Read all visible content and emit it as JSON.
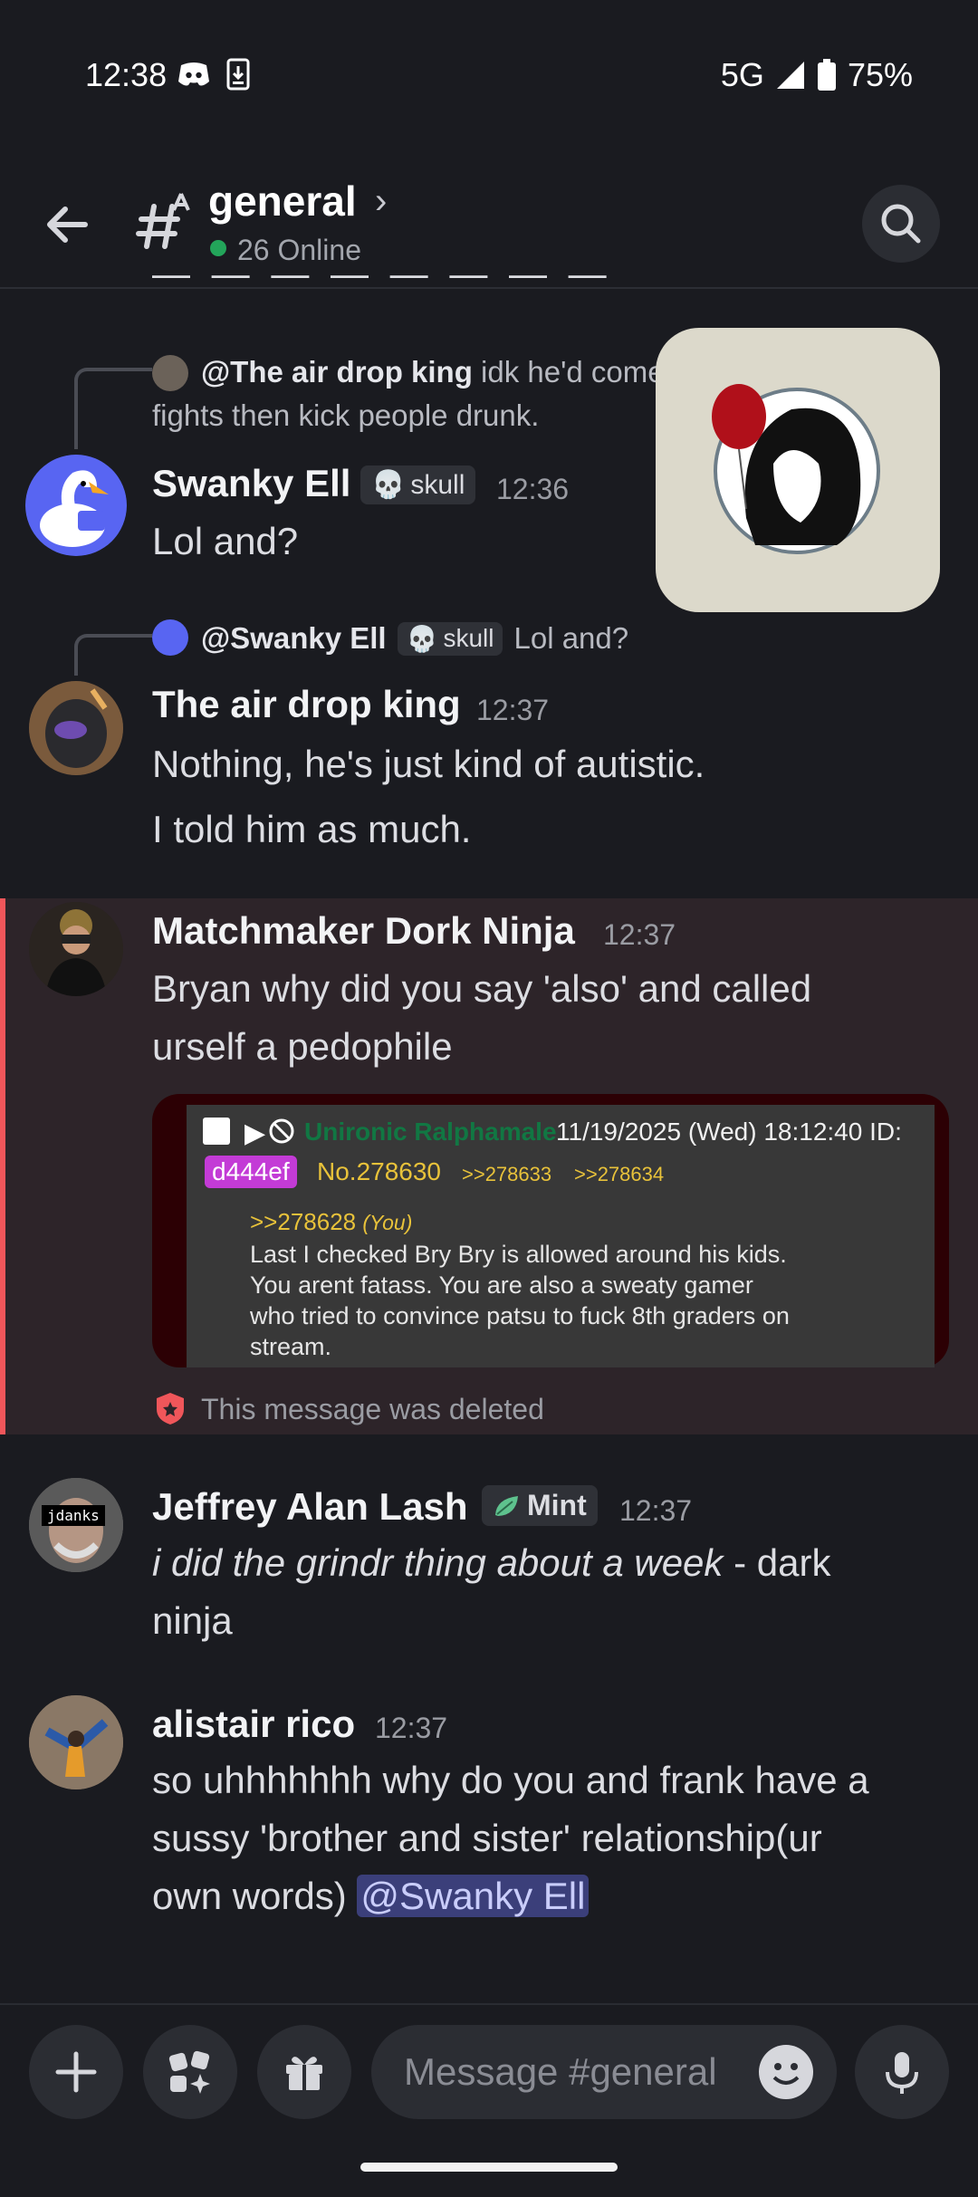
{
  "status_bar": {
    "time": "12:38",
    "network": "5G",
    "battery": "75%"
  },
  "header": {
    "channel_name": "general",
    "online": "26 Online"
  },
  "messages": [
    {
      "reply_to": {
        "user": "@The air drop king",
        "text_line1": "idk he'd come",
        "text_line2": "fights then kick people drunk."
      },
      "user": "Swanky Ell",
      "tag": "skull",
      "time": "12:36",
      "lines": [
        "Lol and?"
      ]
    },
    {
      "reply_to": {
        "user": "@Swanky Ell",
        "tag": "skull",
        "text": "Lol and?"
      },
      "user": "The air drop king",
      "time": "12:37",
      "lines": [
        "Nothing, he's just kind of autistic.",
        "I told him as much."
      ]
    },
    {
      "user": "Matchmaker Dork Ninja",
      "time": "12:37",
      "lines": [
        "Bryan why did you say 'also' and called",
        "urself a pedophile"
      ],
      "embed": {
        "poster": "Unironic Ralphamale",
        "date": "11/19/2025 (Wed) 18:12:40 ID:",
        "id": "d444ef",
        "post_no": "No.278630",
        "refs": [
          ">>278633",
          ">>278634"
        ],
        "quote_ref": ">>278628",
        "quote_you": "(You)",
        "body": [
          "Last I checked Bry Bry is allowed around his kids.",
          "You arent fatass. You are also a sweaty gamer",
          "who tried to convince patsu to fuck 8th graders on",
          "stream."
        ]
      },
      "deleted": "This message was deleted"
    },
    {
      "user": "Jeffrey Alan Lash",
      "tag": "Mint",
      "time": "12:37",
      "avatar_text": "jdanks",
      "line1_italic": "i did the grindr thing about a week",
      "line1_rest": " - dark",
      "line2": "ninja"
    },
    {
      "user": "alistair rico",
      "time": "12:37",
      "lines": [
        "so uhhhhhhh why do you and frank have a",
        "sussy 'brother and sister' relationship(ur",
        "own words) "
      ],
      "mention": "@Swanky Ell"
    }
  ],
  "composer": {
    "placeholder": "Message #general"
  },
  "colors": {
    "accent_online": "#23a55a",
    "highlight_bar": "#f0565a",
    "mention_bg": "#3b3f7a",
    "poster_green": "#117743",
    "id_badge": "#c33bd6"
  }
}
